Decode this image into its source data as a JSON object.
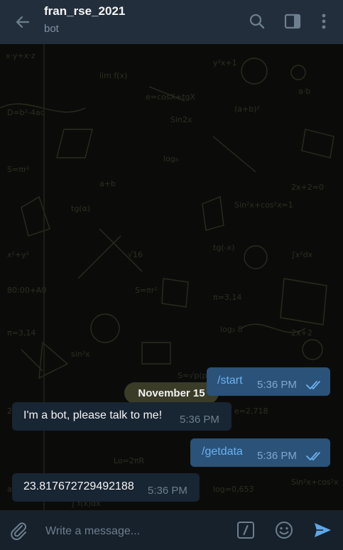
{
  "header": {
    "title": "fran_rse_2021",
    "subtitle": "bot"
  },
  "chat": {
    "date": "November 15",
    "messages": [
      {
        "direction": "out",
        "text": "/start",
        "time": "5:36 PM",
        "status": "read"
      },
      {
        "direction": "in",
        "text": "I'm a bot, please talk to me!",
        "time": "5:36 PM"
      },
      {
        "direction": "out",
        "text": "/getdata",
        "time": "5:36 PM",
        "status": "read"
      },
      {
        "direction": "in",
        "text": "23.817672729492188",
        "time": "5:36 PM"
      }
    ]
  },
  "composer": {
    "placeholder": "Write a message..."
  },
  "icons": {
    "back": "back-arrow-icon",
    "search": "search-icon",
    "sidebar": "sidebar-toggle-icon",
    "menu": "more-vertical-icon",
    "attach": "paperclip-icon",
    "commands": "bot-commands-icon",
    "emoji": "emoji-icon",
    "send": "send-icon"
  },
  "colors": {
    "header_bg": "#232e3c",
    "chat_bg": "#0b0c0a",
    "outgoing_bubble": "#2b5278",
    "incoming_bubble": "#182533",
    "accent": "#5ea8e8",
    "composer_bg": "#17212b"
  }
}
